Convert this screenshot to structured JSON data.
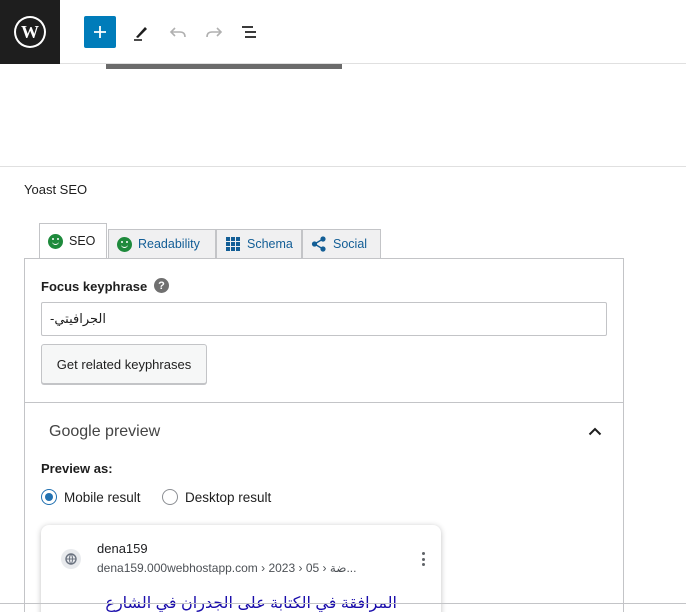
{
  "toolbar": {
    "logo_letter": "W",
    "add_icon": "plus-icon",
    "tools_icon": "pen-icon",
    "undo_icon": "undo-icon",
    "redo_icon": "redo-icon",
    "outline_icon": "list-view-icon"
  },
  "yoast": {
    "title": "Yoast SEO",
    "tabs": [
      {
        "label": "SEO",
        "icon": "smiley-icon",
        "color": "#1e8a3c"
      },
      {
        "label": "Readability",
        "icon": "smiley-icon",
        "color": "#1e8a3c"
      },
      {
        "label": "Schema",
        "icon": "grid-icon"
      },
      {
        "label": "Social",
        "icon": "share-icon"
      }
    ],
    "focus_label": "Focus keyphrase",
    "help_glyph": "?",
    "focus_value": "الجرافيتي-",
    "related_button": "Get related keyphrases"
  },
  "google_preview": {
    "title": "Google preview",
    "preview_as": "Preview as:",
    "options": [
      {
        "label": "Mobile result",
        "checked": true
      },
      {
        "label": "Desktop result",
        "checked": false
      }
    ],
    "site_name": "dena159",
    "url": "dena159.000webhostapp.com › 2023 › 05 › ضة...",
    "result_title": "المرافقة في الكتابة على الجدران في الشارع"
  },
  "colors": {
    "accent": "#007cba",
    "link": "#1a0dab",
    "good": "#1e8a3c"
  }
}
